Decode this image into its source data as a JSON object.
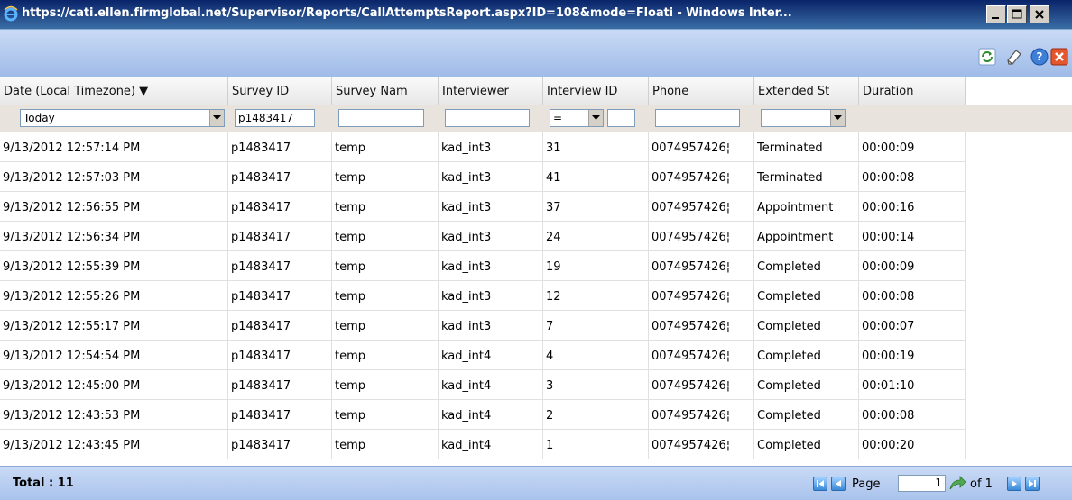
{
  "window": {
    "title": "https://cati.ellen.firmglobal.net/Supervisor/Reports/CallAttemptsReport.aspx?ID=108&mode=Floati - Windows Inter..."
  },
  "toolbar": {
    "icons": [
      "refresh-icon",
      "eraser-icon",
      "help-icon",
      "close-icon"
    ]
  },
  "columns": [
    {
      "key": "date",
      "label": "Date (Local Timezone) ▼"
    },
    {
      "key": "survey_id",
      "label": "Survey ID"
    },
    {
      "key": "survey_name",
      "label": "Survey Nam"
    },
    {
      "key": "interviewer",
      "label": "Interviewer"
    },
    {
      "key": "interview_id",
      "label": "Interview ID"
    },
    {
      "key": "phone",
      "label": "Phone"
    },
    {
      "key": "extended",
      "label": "Extended St"
    },
    {
      "key": "duration",
      "label": "Duration"
    }
  ],
  "filters": {
    "date_value": "Today",
    "survey_id_value": "p1483417",
    "survey_name_value": "",
    "interviewer_value": "",
    "interview_id_op": "=",
    "interview_id_value": "",
    "phone_value": "",
    "extended_value": ""
  },
  "rows": [
    [
      "9/13/2012 12:57:14 PM",
      "p1483417",
      "temp",
      "kad_int3",
      "31",
      "0074957426¦",
      "Terminated",
      "00:00:09"
    ],
    [
      "9/13/2012 12:57:03 PM",
      "p1483417",
      "temp",
      "kad_int3",
      "41",
      "0074957426¦",
      "Terminated",
      "00:00:08"
    ],
    [
      "9/13/2012 12:56:55 PM",
      "p1483417",
      "temp",
      "kad_int3",
      "37",
      "0074957426¦",
      "Appointment",
      "00:00:16"
    ],
    [
      "9/13/2012 12:56:34 PM",
      "p1483417",
      "temp",
      "kad_int3",
      "24",
      "0074957426¦",
      "Appointment",
      "00:00:14"
    ],
    [
      "9/13/2012 12:55:39 PM",
      "p1483417",
      "temp",
      "kad_int3",
      "19",
      "0074957426¦",
      "Completed",
      "00:00:09"
    ],
    [
      "9/13/2012 12:55:26 PM",
      "p1483417",
      "temp",
      "kad_int3",
      "12",
      "0074957426¦",
      "Completed",
      "00:00:08"
    ],
    [
      "9/13/2012 12:55:17 PM",
      "p1483417",
      "temp",
      "kad_int3",
      "7",
      "0074957426¦",
      "Completed",
      "00:00:07"
    ],
    [
      "9/13/2012 12:54:54 PM",
      "p1483417",
      "temp",
      "kad_int4",
      "4",
      "0074957426¦",
      "Completed",
      "00:00:19"
    ],
    [
      "9/13/2012 12:45:00 PM",
      "p1483417",
      "temp",
      "kad_int4",
      "3",
      "0074957426¦",
      "Completed",
      "00:01:10"
    ],
    [
      "9/13/2012 12:43:53 PM",
      "p1483417",
      "temp",
      "kad_int4",
      "2",
      "0074957426¦",
      "Completed",
      "00:00:08"
    ],
    [
      "9/13/2012 12:43:45 PM",
      "p1483417",
      "temp",
      "kad_int4",
      "1",
      "0074957426¦",
      "Completed",
      "00:00:20"
    ]
  ],
  "footer": {
    "total_label": "Total : 11",
    "page_label": "Page",
    "page_value": "1",
    "of_label": "of 1"
  },
  "colors": {
    "titlebar": "#0a246a",
    "toolbar": "#b8cff2",
    "header": "#f0f0f0",
    "filter_row": "#e8e3dc"
  }
}
